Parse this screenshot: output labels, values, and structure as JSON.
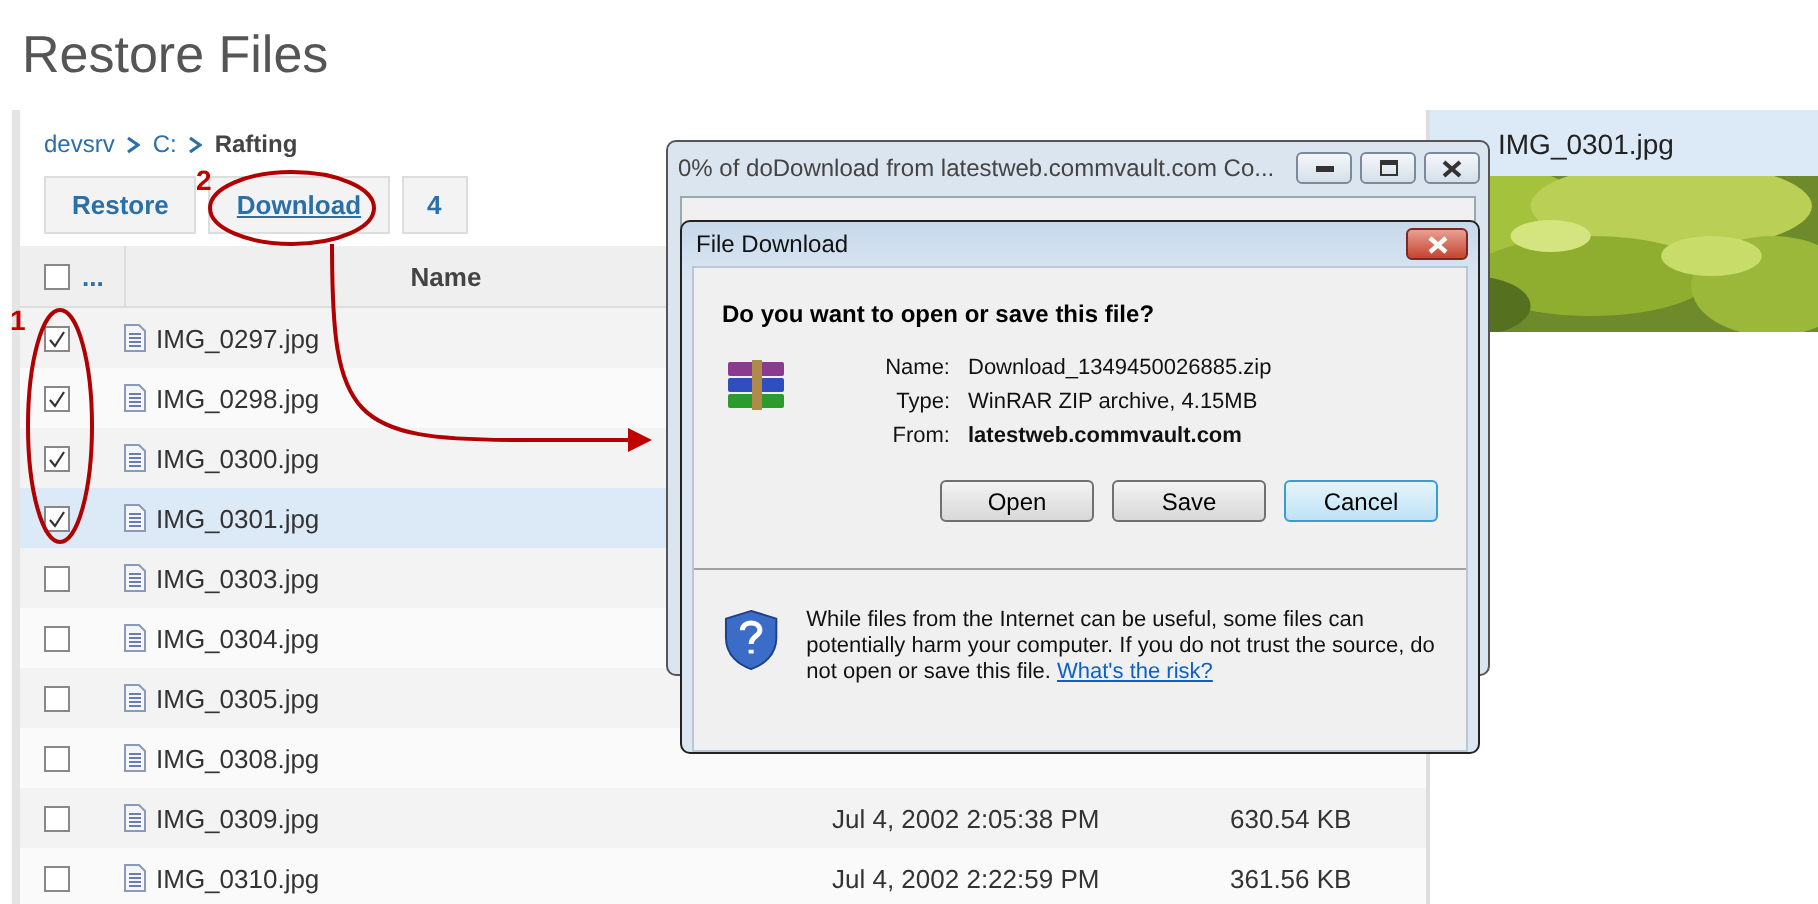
{
  "page": {
    "title": "Restore Files"
  },
  "breadcrumb": [
    {
      "label": "devsrv",
      "current": false
    },
    {
      "label": "C:",
      "current": false
    },
    {
      "label": "Rafting",
      "current": true
    }
  ],
  "toolbar": [
    {
      "label": "Restore",
      "kind": "plain"
    },
    {
      "label": "Download",
      "kind": "link"
    },
    {
      "label": "4",
      "kind": "count"
    }
  ],
  "table": {
    "select_all": false,
    "columns": [
      "...",
      "Name"
    ],
    "rows": [
      {
        "name": "IMG_0297.jpg",
        "checked": true,
        "selected": false
      },
      {
        "name": "IMG_0298.jpg",
        "checked": true,
        "selected": false
      },
      {
        "name": "IMG_0300.jpg",
        "checked": true,
        "selected": false
      },
      {
        "name": "IMG_0301.jpg",
        "checked": true,
        "selected": true
      },
      {
        "name": "IMG_0303.jpg",
        "checked": false,
        "selected": false
      },
      {
        "name": "IMG_0304.jpg",
        "checked": false,
        "selected": false
      },
      {
        "name": "IMG_0305.jpg",
        "checked": false,
        "selected": false
      },
      {
        "name": "IMG_0308.jpg",
        "checked": false,
        "selected": false
      },
      {
        "name": "IMG_0309.jpg",
        "checked": false,
        "selected": false,
        "date": "Jul 4, 2002 2:05:38 PM",
        "size": "630.54 KB"
      },
      {
        "name": "IMG_0310.jpg",
        "checked": false,
        "selected": false,
        "date": "Jul 4, 2002 2:22:59 PM",
        "size": "361.56 KB"
      }
    ]
  },
  "preview": {
    "title": "IMG_0301.jpg",
    "kind": "picture"
  },
  "download_window": {
    "title": "0% of doDownload from latestweb.commvault.com Co..."
  },
  "dialog": {
    "title": "File Download",
    "question": "Do you want to open or save this file?",
    "fields": [
      {
        "label": "Name:",
        "value": "Download_1349450026885.zip",
        "bold": false
      },
      {
        "label": "Type:",
        "value": "WinRAR ZIP archive, 4.15MB",
        "bold": false
      },
      {
        "label": "From:",
        "value": "latestweb.commvault.com",
        "bold": true
      }
    ],
    "buttons": [
      {
        "label": "Open",
        "default": false
      },
      {
        "label": "Save",
        "default": false
      },
      {
        "label": "Cancel",
        "default": true
      }
    ],
    "warning": "While files from the Internet can be useful, some files can potentially harm your computer. If you do not trust the source, do not open or save this file.",
    "warning_link": "What's the risk?"
  },
  "annotations": [
    {
      "label": "1"
    },
    {
      "label": "2"
    }
  ]
}
